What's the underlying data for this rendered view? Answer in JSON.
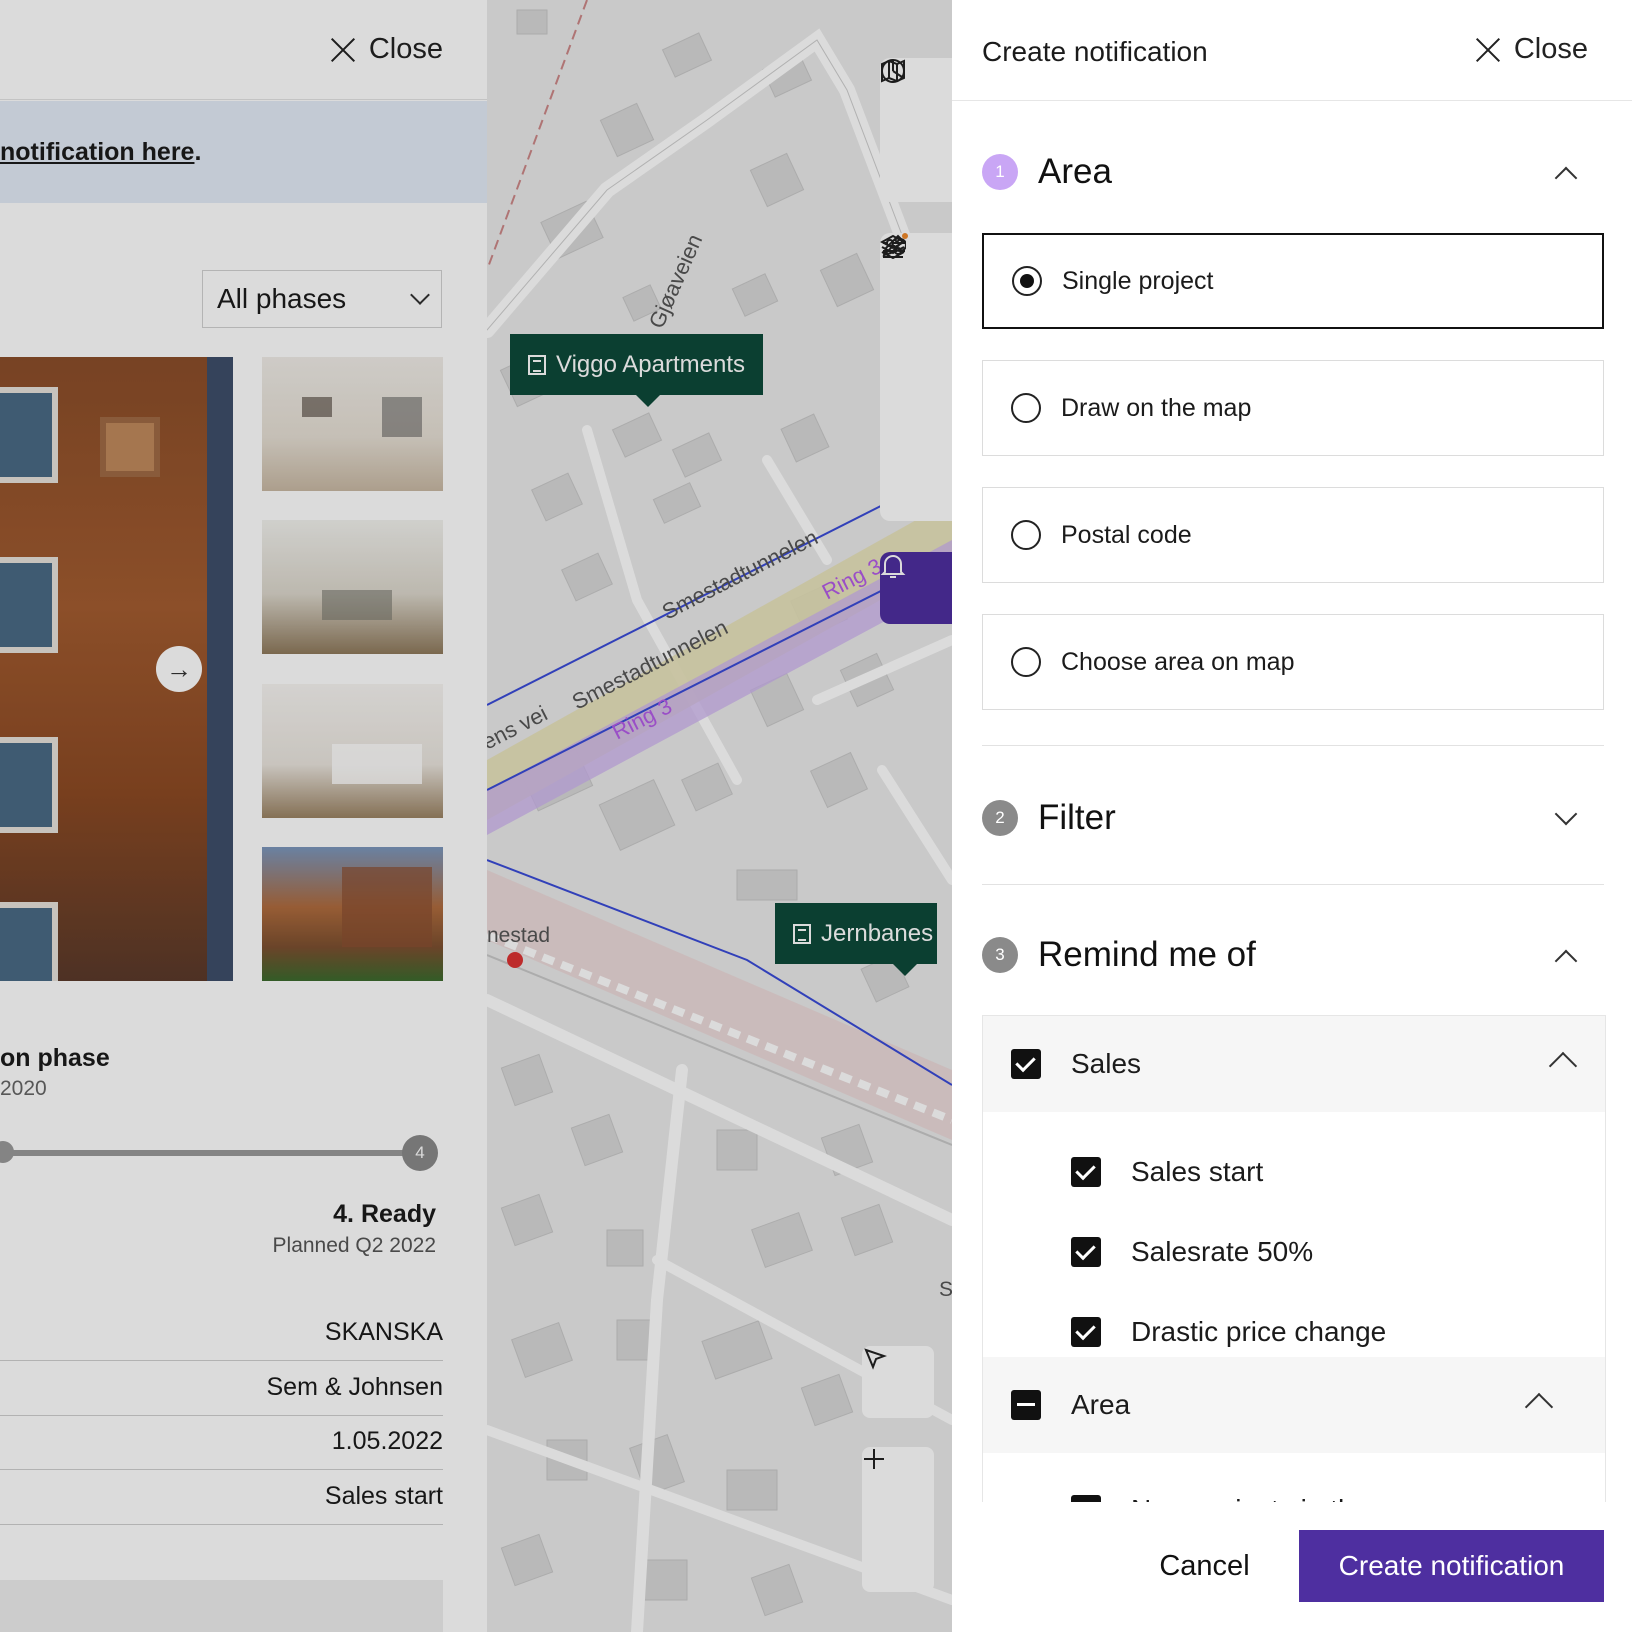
{
  "colors": {
    "accent": "#4e2fa0",
    "poi_bg": "#0d4a3a",
    "area_step": "#c9a6f5",
    "step_inactive": "#8a8a8a"
  },
  "project_panel": {
    "close_label": "Close",
    "banner_text": "notification here",
    "banner_suffix": ".",
    "phase_select": {
      "selected": "All phases"
    },
    "phase_label": "on phase",
    "phase_date": "2020",
    "timeline_end_step": "4",
    "ready_title": "4. Ready",
    "ready_subtitle": "Planned Q2 2022",
    "details": [
      "SKANSKA",
      "Sem & Johnsen",
      "1.05.2022",
      "Sales start"
    ],
    "icons": {
      "next": "arrow-right-icon",
      "dropdown": "chevron-down-icon"
    }
  },
  "map": {
    "street_labels": [
      "Gjøaveien",
      "Smestadtunnelen",
      "Smestadtunnelen",
      "Ring 3",
      "Ring 3",
      "ens vei",
      "nestad",
      "S"
    ],
    "pois": [
      {
        "label": "Viggo Apartments"
      },
      {
        "label": "Jernbanes"
      }
    ],
    "toolbar_icons": [
      "pie-chart-icon",
      "map-icon",
      "sliders-icon",
      "pencil-icon",
      "layers-icon",
      "wrench-icon",
      "bell-icon",
      "cursor-icon",
      "zoom-in-icon",
      "zoom-out-icon"
    ]
  },
  "notification_panel": {
    "title": "Create notification",
    "close_label": "Close",
    "sections": [
      {
        "number": "1",
        "title": "Area",
        "expanded": true
      },
      {
        "number": "2",
        "title": "Filter",
        "expanded": false
      },
      {
        "number": "3",
        "title": "Remind me of",
        "expanded": true
      }
    ],
    "area_options": [
      {
        "label": "Single project",
        "selected": true
      },
      {
        "label": "Draw on the map",
        "selected": false
      },
      {
        "label": "Postal code",
        "selected": false
      },
      {
        "label": "Choose area on map",
        "selected": false
      }
    ],
    "remind": {
      "sales": {
        "label": "Sales",
        "state": "checked",
        "items": [
          {
            "label": "Sales start",
            "checked": true
          },
          {
            "label": "Salesrate 50%",
            "checked": true
          },
          {
            "label": "Drastic price change",
            "checked": true
          }
        ]
      },
      "area": {
        "label": "Area",
        "state": "indeterminate",
        "items": [
          {
            "label": "New projects in the area",
            "checked": true
          }
        ]
      }
    },
    "cancel_label": "Cancel",
    "create_label": "Create notification"
  }
}
